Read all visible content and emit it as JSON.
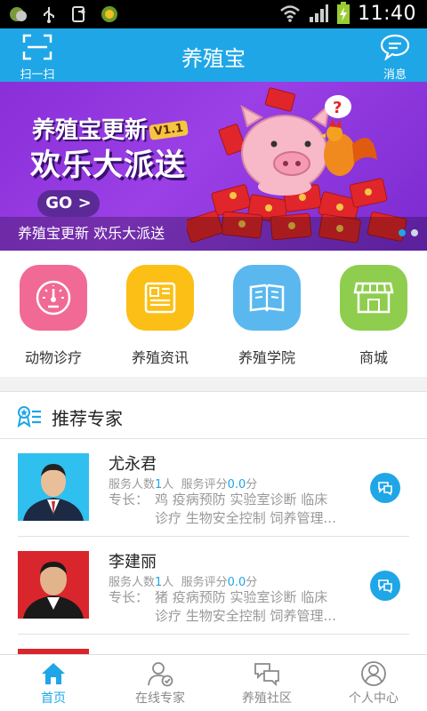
{
  "status_bar": {
    "time": "11:40"
  },
  "header": {
    "title": "养殖宝",
    "scan_label": "扫一扫",
    "message_label": "消息"
  },
  "banner": {
    "headline_line1": "养殖宝更新",
    "version_badge": "V1.1",
    "headline_line2": "欢乐大派送",
    "go_label": "GO >",
    "caption": "养殖宝更新 欢乐大派送",
    "slide_count": 2,
    "active_slide": 1
  },
  "categories": [
    {
      "label": "动物诊疗",
      "icon": "gauge-icon",
      "color": "#f06a95"
    },
    {
      "label": "养殖资讯",
      "icon": "newspaper-icon",
      "color": "#fbbf16"
    },
    {
      "label": "养殖学院",
      "icon": "book-icon",
      "color": "#5ab8ee"
    },
    {
      "label": "商城",
      "icon": "storefront-icon",
      "color": "#8fcd4e"
    }
  ],
  "experts_section": {
    "title": "推荐专家",
    "icon": "expert-badge-icon"
  },
  "experts": [
    {
      "name": "尤永君",
      "served_label": "服务人数",
      "served_count": "1",
      "served_unit": "人",
      "rating_label": "服务评分",
      "rating": "0.0",
      "rating_unit": "分",
      "specialty_label": "专长：",
      "specialty_line1": "鸡 疫病预防 实验室诊断 临床",
      "specialty_line2": "诊疗 生物安全控制 饲养管理..."
    },
    {
      "name": "李建丽",
      "served_label": "服务人数",
      "served_count": "1",
      "served_unit": "人",
      "rating_label": "服务评分",
      "rating": "0.0",
      "rating_unit": "分",
      "specialty_label": "专长：",
      "specialty_line1": "猪 疫病预防 实验室诊断 临床",
      "specialty_line2": "诊疗 生物安全控制 饲养管理..."
    }
  ],
  "tabs": [
    {
      "label": "首页",
      "icon": "home-icon",
      "active": true
    },
    {
      "label": "在线专家",
      "icon": "online-expert-icon",
      "active": false
    },
    {
      "label": "养殖社区",
      "icon": "community-chat-icon",
      "active": false
    },
    {
      "label": "个人中心",
      "icon": "profile-icon",
      "active": false
    }
  ],
  "colors": {
    "primary": "#1fa6e6",
    "banner_purple": "#8a2fd8",
    "text_dark": "#222222",
    "text_muted": "#999999"
  }
}
